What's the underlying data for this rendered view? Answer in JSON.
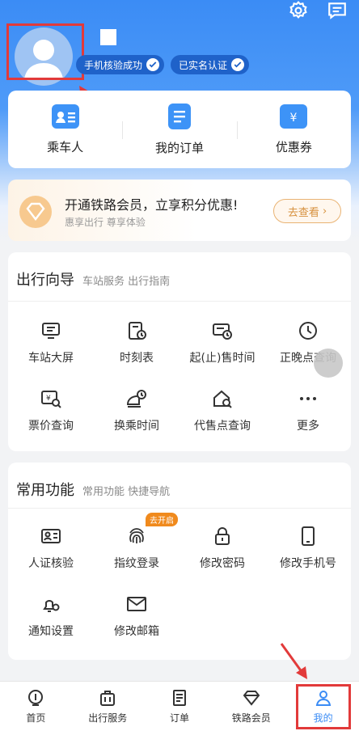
{
  "header": {
    "badges": [
      "手机核验成功",
      "已实名认证"
    ]
  },
  "quick_links": [
    {
      "label": "乘车人",
      "icon": "passenger-card-icon"
    },
    {
      "label": "我的订单",
      "icon": "order-list-icon"
    },
    {
      "label": "优惠券",
      "icon": "coupon-icon"
    }
  ],
  "vip": {
    "title": "开通铁路会员，立享积分优惠!",
    "subtitle": "惠享出行 尊享体验",
    "button": "去查看"
  },
  "travel_guide": {
    "title": "出行向导",
    "subtitle": "车站服务 出行指南",
    "items": [
      "车站大屏",
      "时刻表",
      "起(止)售时间",
      "正晚点查询",
      "票价查询",
      "换乘时间",
      "代售点查询",
      "更多"
    ]
  },
  "common": {
    "title": "常用功能",
    "subtitle": "常用功能 快捷导航",
    "items": [
      "人证核验",
      "指纹登录",
      "修改密码",
      "修改手机号",
      "通知设置",
      "修改邮箱"
    ],
    "tag": "去开启"
  },
  "tabs": [
    "首页",
    "出行服务",
    "订单",
    "铁路会员",
    "我的"
  ],
  "active_tab": "我的",
  "colors": {
    "accent": "#3b8cf5",
    "highlight_box": "#e23a3a",
    "vip_orange": "#d7913e"
  }
}
